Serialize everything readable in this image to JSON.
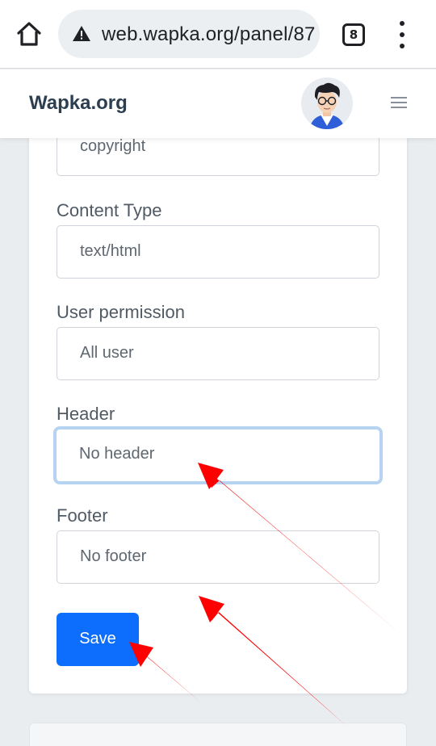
{
  "browser": {
    "url": "web.wapka.org/panel/87",
    "tab_count": "8"
  },
  "site": {
    "brand": "Wapka.org"
  },
  "form": {
    "partial_field_value": "copyright",
    "content_type": {
      "label": "Content Type",
      "value": "text/html"
    },
    "user_permission": {
      "label": "User permission",
      "value": "All user"
    },
    "header": {
      "label": "Header",
      "value": "No header"
    },
    "footer": {
      "label": "Footer",
      "value": "No footer"
    },
    "save_label": "Save"
  },
  "colors": {
    "primary_button": "#0d6efd",
    "focus_ring": "#b7d3f2",
    "annotation_arrow": "#ff0000"
  }
}
